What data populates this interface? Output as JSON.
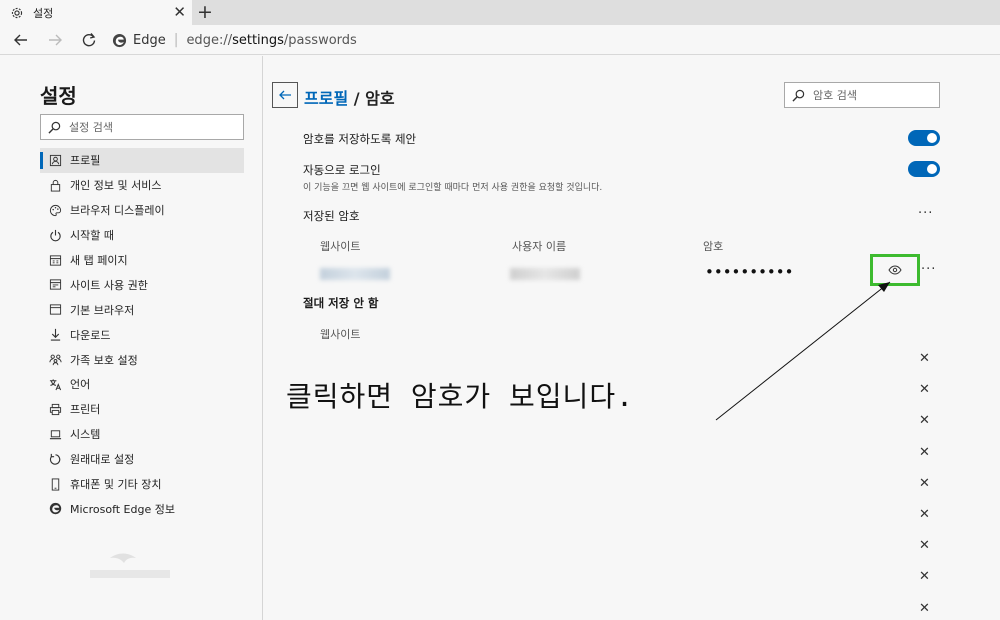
{
  "tab": {
    "title": "설정",
    "close": "✕",
    "new_tab": "+"
  },
  "address": {
    "brand": "Edge",
    "url_prefix": "edge://",
    "url_path": "settings",
    "url_suffix": "/passwords"
  },
  "sidebar": {
    "title": "설정",
    "search_placeholder": "설정 검색",
    "items": [
      {
        "label": "프로필",
        "icon": "profile-icon"
      },
      {
        "label": "개인 정보 및 서비스",
        "icon": "lock-icon"
      },
      {
        "label": "브라우저 디스플레이",
        "icon": "palette-icon"
      },
      {
        "label": "시작할 때",
        "icon": "power-icon"
      },
      {
        "label": "새 탭 페이지",
        "icon": "grid-icon"
      },
      {
        "label": "사이트 사용 권한",
        "icon": "site-permissions-icon"
      },
      {
        "label": "기본 브라우저",
        "icon": "browser-icon"
      },
      {
        "label": "다운로드",
        "icon": "download-icon"
      },
      {
        "label": "가족 보호 설정",
        "icon": "family-icon"
      },
      {
        "label": "언어",
        "icon": "language-icon"
      },
      {
        "label": "프린터",
        "icon": "printer-icon"
      },
      {
        "label": "시스템",
        "icon": "laptop-icon"
      },
      {
        "label": "원래대로 설정",
        "icon": "reset-icon"
      },
      {
        "label": "휴대폰 및 기타 장치",
        "icon": "phone-icon"
      },
      {
        "label": "Microsoft Edge 정보",
        "icon": "edge-icon"
      }
    ]
  },
  "main": {
    "breadcrumb_link": "프로필",
    "breadcrumb_sep": " / ",
    "breadcrumb_current": "암호",
    "search_placeholder": "암호 검색",
    "offer_save": {
      "label": "암호를 저장하도록 제안",
      "on": true
    },
    "auto_signin": {
      "label": "자동으로 로그인",
      "description": "이 기능을 끄면 웹 사이트에 로그인할 때마다 먼저 사용 권한을 요청할 것입니다.",
      "on": true
    },
    "saved_title": "저장된 암호",
    "columns": {
      "website": "웹사이트",
      "username": "사용자 이름",
      "password": "암호"
    },
    "saved_password_mask": "••••••••••",
    "never_saved_title": "절대 저장 안 함",
    "never_saved_column": "웹사이트",
    "never_saved_count": 9,
    "more": "···",
    "remove": "✕"
  },
  "annotation": "클릭하면 암호가 보입니다.",
  "colors": {
    "accent": "#0067b8",
    "highlight": "#3dbb2f"
  }
}
